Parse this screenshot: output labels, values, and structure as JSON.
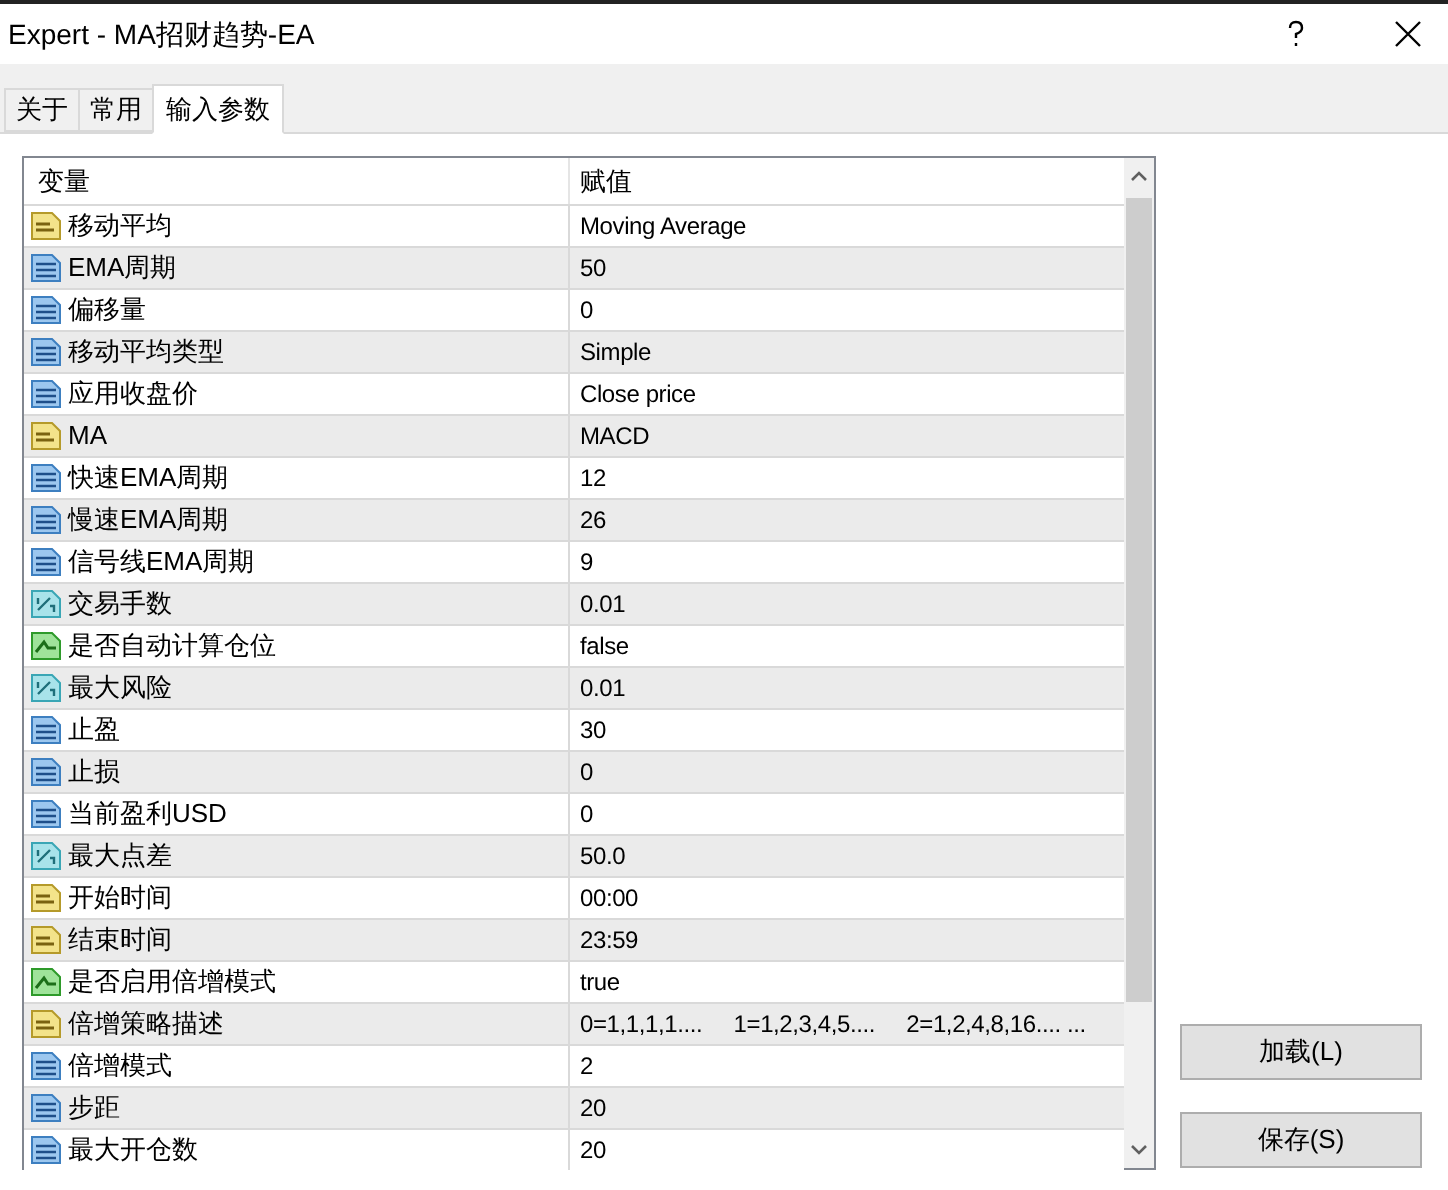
{
  "window": {
    "title": "Expert - MA招财趋势-EA"
  },
  "tabs": [
    {
      "label": "关于",
      "selected": false
    },
    {
      "label": "常用",
      "selected": false
    },
    {
      "label": "输入参数",
      "selected": true
    }
  ],
  "table": {
    "columns": [
      "变量",
      "赋值"
    ],
    "rows": [
      {
        "kind": "string",
        "name": "移动平均",
        "value": "Moving Average"
      },
      {
        "kind": "integer",
        "name": "EMA周期",
        "value": "50"
      },
      {
        "kind": "integer",
        "name": "偏移量",
        "value": "0"
      },
      {
        "kind": "integer",
        "name": "移动平均类型",
        "value": "Simple"
      },
      {
        "kind": "integer",
        "name": "应用收盘价",
        "value": "Close price"
      },
      {
        "kind": "string",
        "name": "MA",
        "value": "MACD"
      },
      {
        "kind": "integer",
        "name": "快速EMA周期",
        "value": "12"
      },
      {
        "kind": "integer",
        "name": "慢速EMA周期",
        "value": "26"
      },
      {
        "kind": "integer",
        "name": "信号线EMA周期",
        "value": "9"
      },
      {
        "kind": "double",
        "name": "交易手数",
        "value": "0.01"
      },
      {
        "kind": "bool",
        "name": "是否自动计算仓位",
        "value": "false"
      },
      {
        "kind": "double",
        "name": "最大风险",
        "value": "0.01"
      },
      {
        "kind": "integer",
        "name": "止盈",
        "value": "30"
      },
      {
        "kind": "integer",
        "name": "止损",
        "value": "0"
      },
      {
        "kind": "integer",
        "name": "当前盈利USD",
        "value": "0"
      },
      {
        "kind": "double",
        "name": "最大点差",
        "value": "50.0"
      },
      {
        "kind": "string",
        "name": "开始时间",
        "value": "00:00"
      },
      {
        "kind": "string",
        "name": "结束时间",
        "value": "23:59"
      },
      {
        "kind": "bool",
        "name": "是否启用倍增模式",
        "value": "true"
      },
      {
        "kind": "string",
        "name": "倍增策略描述",
        "value": "0=1,1,1,1....     1=1,2,3,4,5....     2=1,2,4,8,16.... ..."
      },
      {
        "kind": "integer",
        "name": "倍增模式",
        "value": "2"
      },
      {
        "kind": "integer",
        "name": "步距",
        "value": "20"
      },
      {
        "kind": "integer",
        "name": "最大开仓数",
        "value": "20"
      }
    ]
  },
  "side_buttons": [
    "加载(L)",
    "保存(S)"
  ]
}
